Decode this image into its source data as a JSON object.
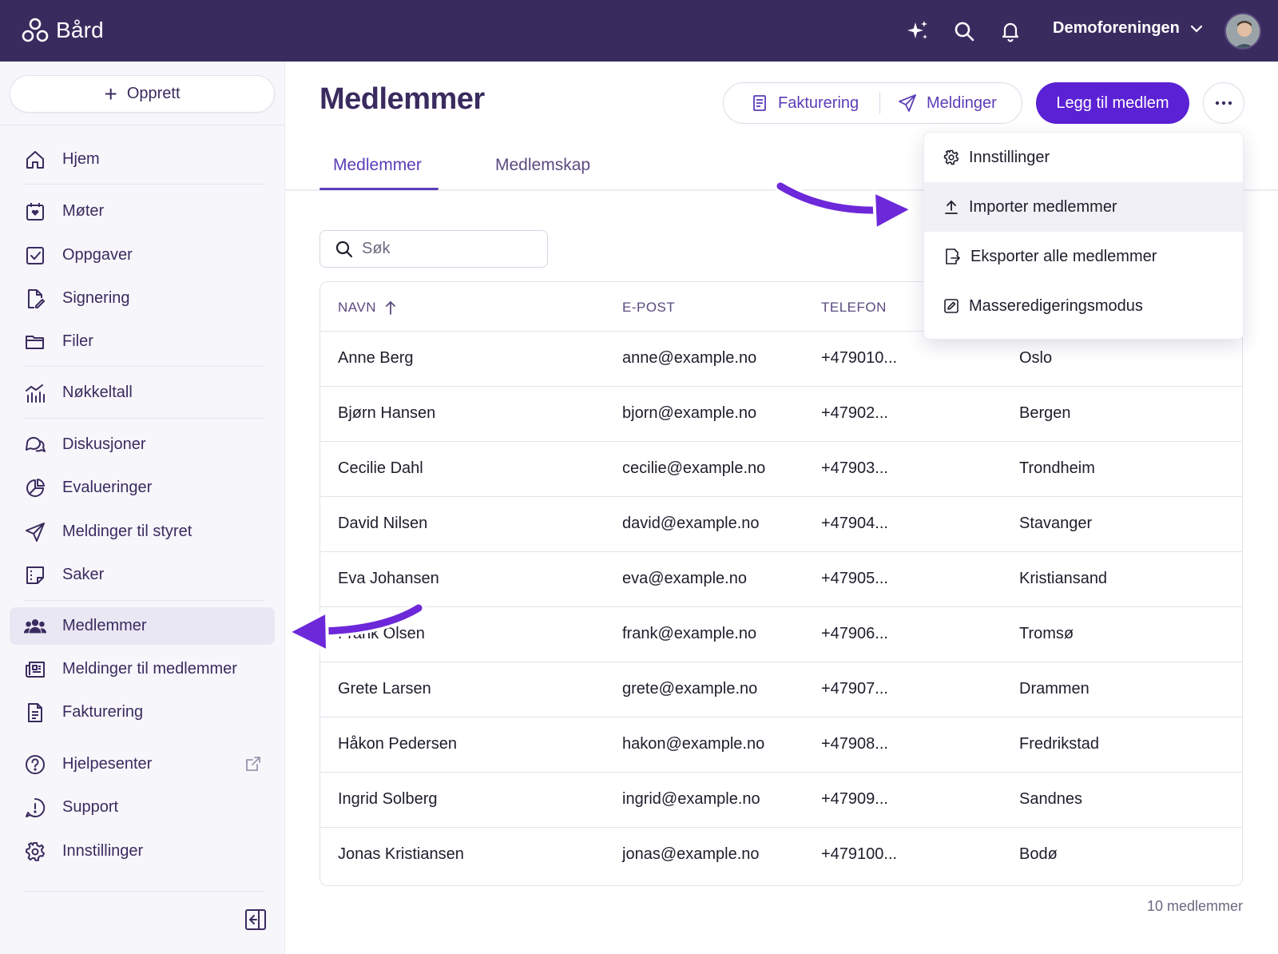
{
  "app": {
    "name": "Bård"
  },
  "topbar": {
    "organization": "Demoforeningen"
  },
  "sidebar": {
    "create_label": "Opprett",
    "items": [
      {
        "label": "Hjem",
        "icon": "home-icon"
      },
      {
        "label": "Møter",
        "icon": "calendar-icon"
      },
      {
        "label": "Oppgaver",
        "icon": "checkbox-icon"
      },
      {
        "label": "Signering",
        "icon": "signature-icon"
      },
      {
        "label": "Filer",
        "icon": "folder-icon"
      },
      {
        "label": "Nøkkeltall",
        "icon": "chart-icon"
      },
      {
        "label": "Diskusjoner",
        "icon": "chat-icon"
      },
      {
        "label": "Evalueringer",
        "icon": "pie-icon"
      },
      {
        "label": "Meldinger til styret",
        "icon": "send-icon"
      },
      {
        "label": "Saker",
        "icon": "note-icon"
      },
      {
        "label": "Medlemmer",
        "icon": "users-icon",
        "active": true
      },
      {
        "label": "Meldinger til medlemmer",
        "icon": "newspaper-icon"
      },
      {
        "label": "Fakturering",
        "icon": "invoice-icon"
      },
      {
        "label": "Hjelpesenter",
        "icon": "help-icon",
        "external": true
      },
      {
        "label": "Support",
        "icon": "support-icon"
      },
      {
        "label": "Innstillinger",
        "icon": "gear-icon"
      }
    ]
  },
  "main": {
    "title": "Medlemmer",
    "actions": {
      "billing": "Fakturering",
      "messages": "Meldinger",
      "add_member": "Legg til medlem"
    },
    "tabs": [
      {
        "label": "Medlemmer",
        "active": true
      },
      {
        "label": "Medlemskap",
        "active": false
      }
    ],
    "search": {
      "placeholder": "Søk",
      "value": ""
    },
    "table": {
      "columns": [
        "NAVN",
        "E-POST",
        "TELEFON"
      ],
      "sort_column": "NAVN",
      "sort_direction": "ascending",
      "rows": [
        {
          "name": "Anne Berg",
          "email": "anne@example.no",
          "phone": "+479010...",
          "city": "Oslo"
        },
        {
          "name": "Bjørn Hansen",
          "email": "bjorn@example.no",
          "phone": "+47902...",
          "city": "Bergen"
        },
        {
          "name": "Cecilie Dahl",
          "email": "cecilie@example.no",
          "phone": "+47903...",
          "city": "Trondheim"
        },
        {
          "name": "David Nilsen",
          "email": "david@example.no",
          "phone": "+47904...",
          "city": "Stavanger"
        },
        {
          "name": "Eva Johansen",
          "email": "eva@example.no",
          "phone": "+47905...",
          "city": "Kristiansand"
        },
        {
          "name": "Frank Olsen",
          "email": "frank@example.no",
          "phone": "+47906...",
          "city": "Tromsø"
        },
        {
          "name": "Grete Larsen",
          "email": "grete@example.no",
          "phone": "+47907...",
          "city": "Drammen"
        },
        {
          "name": "Håkon Pedersen",
          "email": "hakon@example.no",
          "phone": "+47908...",
          "city": "Fredrikstad"
        },
        {
          "name": "Ingrid Solberg",
          "email": "ingrid@example.no",
          "phone": "+47909...",
          "city": "Sandnes"
        },
        {
          "name": "Jonas Kristiansen",
          "email": "jonas@example.no",
          "phone": "+479100...",
          "city": "Bodø"
        }
      ]
    },
    "footer_count": "10 medlemmer"
  },
  "dropdown": {
    "items": [
      {
        "label": "Innstillinger",
        "icon": "gear-icon"
      },
      {
        "label": "Importer medlemmer",
        "icon": "upload-icon",
        "highlighted": true
      },
      {
        "label": "Eksporter alle medlemmer",
        "icon": "export-icon"
      },
      {
        "label": "Masseredigeringsmodus",
        "icon": "edit-square-icon"
      }
    ]
  },
  "colors": {
    "topbar": "#3a2b5f",
    "accent": "#5b21d4",
    "annotation_arrow": "#6d28d9"
  }
}
